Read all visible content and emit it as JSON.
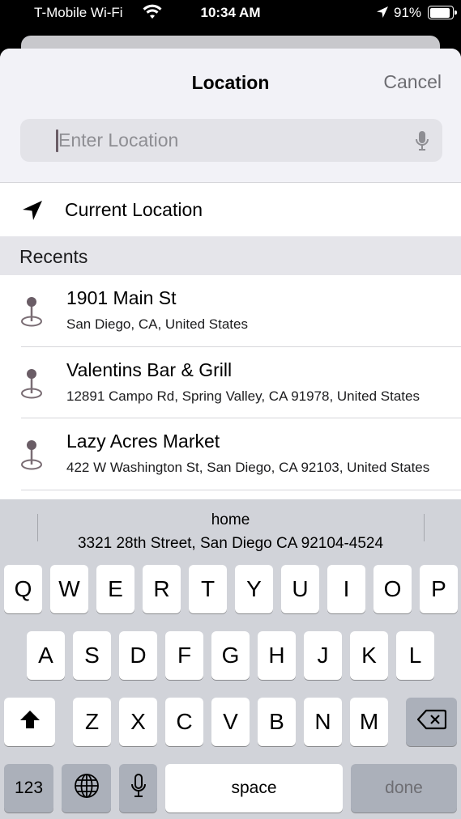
{
  "status_bar": {
    "carrier": "T-Mobile Wi-Fi",
    "time": "10:34 AM",
    "battery": "91%",
    "battery_level": 0.91
  },
  "header": {
    "title": "Location",
    "cancel_label": "Cancel"
  },
  "search": {
    "placeholder": "Enter Location",
    "value": ""
  },
  "current_location": {
    "label": "Current Location"
  },
  "recents": {
    "header": "Recents",
    "items": [
      {
        "name": "1901 Main St",
        "address": "San Diego, CA, United States"
      },
      {
        "name": "Valentins Bar & Grill",
        "address": "12891 Campo Rd, Spring Valley, CA  91978, United States"
      },
      {
        "name": "Lazy Acres Market",
        "address": "422 W Washington St, San Diego, CA  92103, United States"
      }
    ]
  },
  "keyboard": {
    "suggestion": {
      "title": "home",
      "address": "3321 28th Street, San Diego CA 92104-4524"
    },
    "row1": [
      "Q",
      "W",
      "E",
      "R",
      "T",
      "Y",
      "U",
      "I",
      "O",
      "P"
    ],
    "row2": [
      "A",
      "S",
      "D",
      "F",
      "G",
      "H",
      "J",
      "K",
      "L"
    ],
    "row3": [
      "Z",
      "X",
      "C",
      "V",
      "B",
      "N",
      "M"
    ],
    "numbers_label": "123",
    "space_label": "space",
    "done_label": "done"
  },
  "icons": {
    "wifi": "wifi-icon",
    "location_arrow": "location-arrow-icon",
    "mic": "microphone-icon",
    "pin": "map-pin-icon",
    "shift": "shift-icon",
    "delete": "delete-icon",
    "globe": "globe-icon"
  }
}
